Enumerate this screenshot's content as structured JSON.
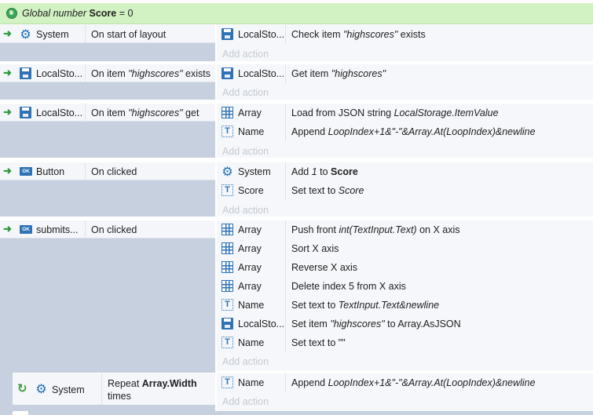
{
  "global_var": {
    "prefix": "Global number",
    "name": "Score",
    "suffix": "= 0"
  },
  "add_action_label": "Add action",
  "events": [
    {
      "condition": {
        "object": "System",
        "icon": "gear-icon",
        "text": "On start of layout"
      },
      "actions": [
        {
          "object": "LocalSto...",
          "icon": "local-storage-icon",
          "text_plain": "Check item ",
          "text_italic": "\"highscores\"",
          "text_tail": " exists"
        }
      ]
    },
    {
      "condition": {
        "object": "LocalSto...",
        "icon": "local-storage-icon",
        "text_plain": "On item ",
        "text_italic": "\"highscores\"",
        "text_tail": " exists"
      },
      "actions": [
        {
          "object": "LocalSto...",
          "icon": "local-storage-icon",
          "text_plain": "Get item ",
          "text_italic": "\"highscores\""
        }
      ]
    },
    {
      "condition": {
        "object": "LocalSto...",
        "icon": "local-storage-icon",
        "text_plain": "On item ",
        "text_italic": "\"highscores\"",
        "text_tail": " get"
      },
      "actions": [
        {
          "object": "Array",
          "icon": "array-icon",
          "text_plain": "Load from JSON string ",
          "text_italic": "LocalStorage.ItemValue"
        },
        {
          "object": "Name",
          "icon": "text-object-icon",
          "text_plain": "Append ",
          "text_italic": "LoopIndex+1&\"-\"&Array.At(LoopIndex)&newline"
        }
      ]
    },
    {
      "condition": {
        "object": "Button",
        "icon": "button-icon",
        "text": "On clicked"
      },
      "actions": [
        {
          "object": "System",
          "icon": "gear-icon",
          "text_plain": "Add ",
          "text_italic": "1",
          "text_mid": " to ",
          "text_bold": "Score"
        },
        {
          "object": "Score",
          "icon": "text-object-icon",
          "text_plain": "Set text to ",
          "text_italic": "Score"
        }
      ]
    },
    {
      "condition": {
        "object": "submits...",
        "icon": "button-icon",
        "text": "On clicked"
      },
      "actions": [
        {
          "object": "Array",
          "icon": "array-icon",
          "text_plain": "Push front ",
          "text_italic": "int(TextInput.Text)",
          "text_tail": " on X axis"
        },
        {
          "object": "Array",
          "icon": "array-icon",
          "text_plain": "Sort X axis"
        },
        {
          "object": "Array",
          "icon": "array-icon",
          "text_plain": "Reverse X axis"
        },
        {
          "object": "Array",
          "icon": "array-icon",
          "text_plain": "Delete index 5 from X axis"
        },
        {
          "object": "Name",
          "icon": "text-object-icon",
          "text_plain": "Set text to ",
          "text_italic": "TextInput.Text&newline"
        },
        {
          "object": "LocalSto...",
          "icon": "local-storage-icon",
          "text_plain": "Set item ",
          "text_italic": "\"highscores\"",
          "text_tail": " to Array.AsJSON"
        },
        {
          "object": "Name",
          "icon": "text-object-icon",
          "text_plain": "Set text to ",
          "text_tail": "\"\""
        }
      ]
    }
  ],
  "sub_event": {
    "condition": {
      "object": "System",
      "icon": "gear-icon",
      "text_plain": "Repeat ",
      "text_bold": "Array.Width",
      "text_tail": "times"
    },
    "actions": [
      {
        "object": "Name",
        "icon": "text-object-icon",
        "text_plain": "Append ",
        "text_italic": "LoopIndex+1&\"-\"&Array.At(LoopIndex)&newline"
      }
    ]
  },
  "colors": {
    "global_bar": "#d3f2c4",
    "condition_area": "#c6d0df",
    "action_area": "#f5f7fa",
    "icon_blue": "#2f73b6",
    "arrow_green": "#2e9a3e"
  }
}
